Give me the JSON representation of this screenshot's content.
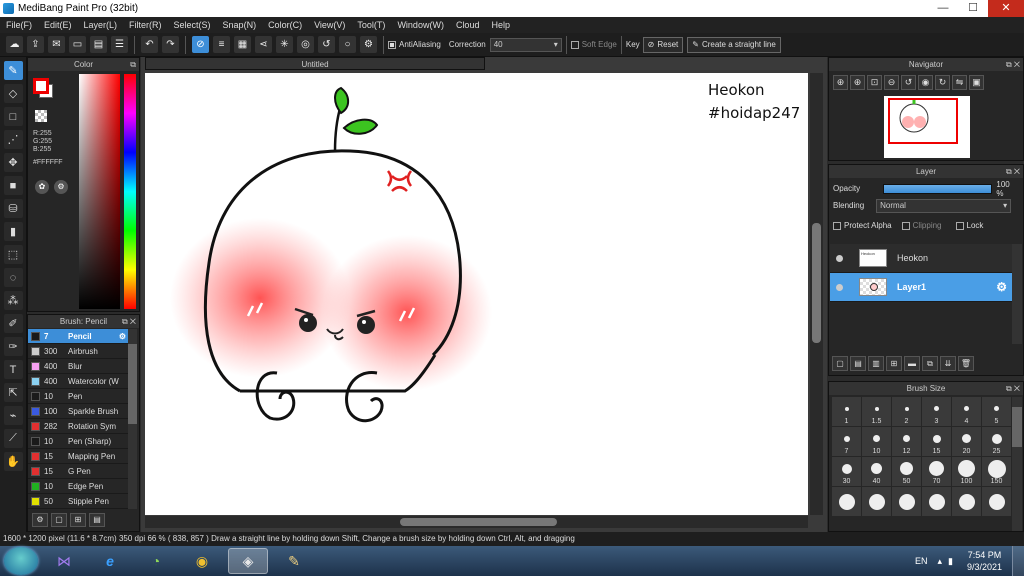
{
  "window": {
    "title": "MediBang Paint Pro (32bit)",
    "minimize": "—",
    "maximize": "☐",
    "close": "✕"
  },
  "menu": [
    "File(F)",
    "Edit(E)",
    "Layer(L)",
    "Filter(R)",
    "Select(S)",
    "Snap(N)",
    "Color(C)",
    "View(V)",
    "Tool(T)",
    "Window(W)",
    "Cloud",
    "Help"
  ],
  "toolbar": {
    "antialiasing": "AntiAliasing",
    "correction_label": "Correction",
    "correction_value": "40",
    "soft_edge": "Soft Edge",
    "key_label": "Key",
    "reset": "Reset",
    "straight_line": "Create a straight line"
  },
  "color_panel": {
    "title": "Color",
    "r": "R:255",
    "g": "G:255",
    "b": "B:255",
    "hex": "#FFFFFF"
  },
  "brush_panel": {
    "title": "Brush: Pencil",
    "items": [
      {
        "size": "7",
        "name": "Pencil",
        "color": "#1a1a1a"
      },
      {
        "size": "300",
        "name": "Airbrush",
        "color": "#cccccc"
      },
      {
        "size": "400",
        "name": "Blur",
        "color": "#f5a0f0"
      },
      {
        "size": "400",
        "name": "Watercolor (W",
        "color": "#8ad0f0"
      },
      {
        "size": "10",
        "name": "Pen",
        "color": "#1a1a1a"
      },
      {
        "size": "100",
        "name": "Sparkle Brush",
        "color": "#3a5ae0"
      },
      {
        "size": "282",
        "name": "Rotation Sym",
        "color": "#e03030"
      },
      {
        "size": "10",
        "name": "Pen (Sharp)",
        "color": "#1a1a1a"
      },
      {
        "size": "15",
        "name": "Mapping Pen",
        "color": "#e03030"
      },
      {
        "size": "15",
        "name": "G Pen",
        "color": "#e03030"
      },
      {
        "size": "10",
        "name": "Edge Pen",
        "color": "#20b020"
      },
      {
        "size": "50",
        "name": "Stipple Pen",
        "color": "#e0e000"
      }
    ]
  },
  "document": {
    "tab": "Untitled",
    "watermark_line1": "Heokon",
    "watermark_line2": "#hoidap247"
  },
  "navigator": {
    "title": "Navigator"
  },
  "layer_panel": {
    "title": "Layer",
    "opacity_label": "Opacity",
    "opacity_value": "100 %",
    "blending_label": "Blending",
    "blending_value": "Normal",
    "protect_alpha": "Protect Alpha",
    "clipping": "Clipping",
    "lock": "Lock",
    "layers": [
      {
        "name": "Heokon"
      },
      {
        "name": "Layer1"
      }
    ]
  },
  "brush_size": {
    "title": "Brush Size",
    "sizes": [
      "1",
      "1.5",
      "2",
      "3",
      "4",
      "5",
      "7",
      "10",
      "12",
      "15",
      "20",
      "25",
      "30",
      "40",
      "50",
      "70",
      "100",
      "150",
      "",
      "",
      "",
      "",
      "",
      ""
    ]
  },
  "status": {
    "pixels": "1600 * 1200 pixel",
    "physical": "(11.6 * 8.7cm)",
    "dpi": "350 dpi",
    "zoom": "66 %",
    "coords": "( 838, 857 )",
    "hint": "Draw a straight line by holding down Shift, Change a brush size by holding down Ctrl, Alt, and dragging"
  },
  "taskbar": {
    "lang": "EN",
    "time": "7:54 PM",
    "date": "9/3/2021"
  },
  "colors": {
    "accent": "#3d8ed8",
    "blush": "#ff5a5a",
    "leaf": "#3cc420",
    "anger": "#e02020"
  }
}
